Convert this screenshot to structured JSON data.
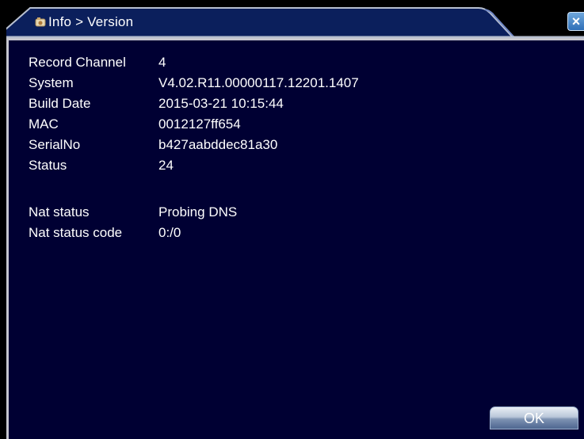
{
  "window": {
    "title": "Info > Version",
    "close_label": "×"
  },
  "info": {
    "rows": [
      {
        "label": "Record Channel",
        "value": "4"
      },
      {
        "label": "System",
        "value": "V4.02.R11.00000117.12201.1407"
      },
      {
        "label": "Build Date",
        "value": "2015-03-21 10:15:44"
      },
      {
        "label": "MAC",
        "value": "0012127ff654"
      },
      {
        "label": "SerialNo",
        "value": "b427aabddec81a30"
      },
      {
        "label": "Status",
        "value": "24"
      }
    ],
    "nat_rows": [
      {
        "label": "Nat status",
        "value": "Probing DNS"
      },
      {
        "label": "Nat status code",
        "value": "0:/0"
      }
    ]
  },
  "buttons": {
    "ok_label": "OK"
  },
  "colors": {
    "panel_background": "#000033",
    "title_bar": "#0b1f5c",
    "text": "#ffffff"
  },
  "icons": {
    "title_icon": "info-icon",
    "close_icon": "close-icon"
  }
}
